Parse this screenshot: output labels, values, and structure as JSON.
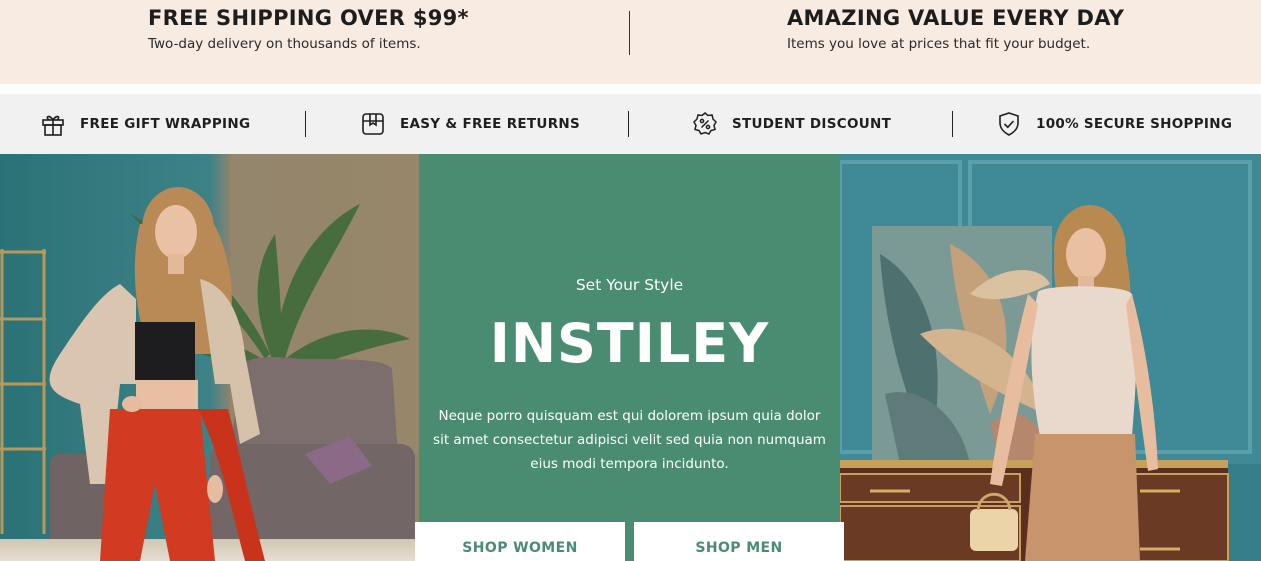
{
  "promos": [
    {
      "title": "FREE SHIPPING OVER $99*",
      "subtitle": "Two-day delivery on thousands of items."
    },
    {
      "title": "AMAZING VALUE EVERY DAY",
      "subtitle": "Items you love at prices that fit your budget."
    }
  ],
  "features": [
    {
      "label": "FREE GIFT WRAPPING",
      "icon": "gift-icon"
    },
    {
      "label": "EASY & FREE RETURNS",
      "icon": "box-icon"
    },
    {
      "label": "STUDENT DISCOUNT",
      "icon": "percent-badge-icon"
    },
    {
      "label": "100% SECURE SHOPPING",
      "icon": "shield-check-icon"
    }
  ],
  "hero": {
    "tagline": "Set Your Style",
    "brand": "INSTILEY",
    "body": "Neque porro quisquam est qui dolorem ipsum quia dolor sit amet consectetur adipisci velit sed quia non numquam eius modi tempora incidunto.",
    "buttons": {
      "women": "SHOP WOMEN",
      "men": "SHOP MEN"
    },
    "colors": {
      "panel": "#4a8c72",
      "promo_bg": "#f8ebe1",
      "features_bg": "#f1f1f1"
    }
  }
}
